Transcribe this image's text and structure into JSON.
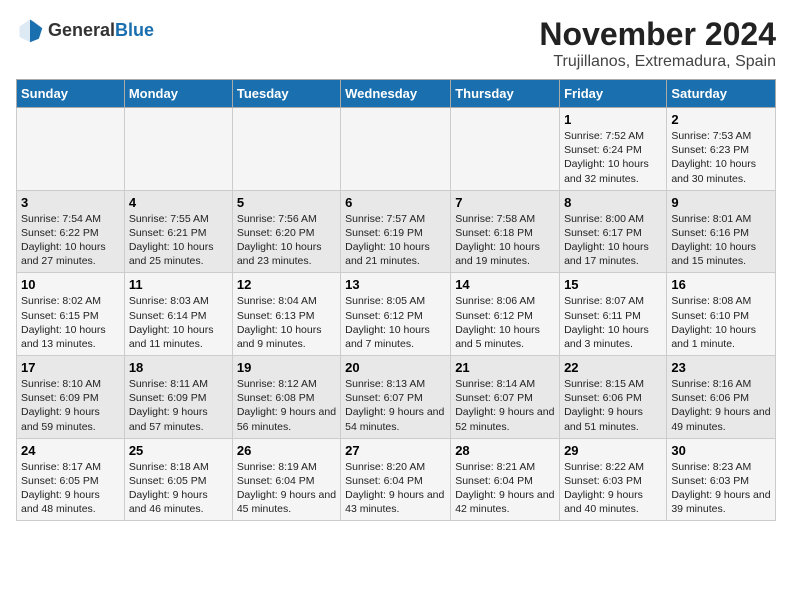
{
  "logo": {
    "text_general": "General",
    "text_blue": "Blue"
  },
  "title": "November 2024",
  "subtitle": "Trujillanos, Extremadura, Spain",
  "days_of_week": [
    "Sunday",
    "Monday",
    "Tuesday",
    "Wednesday",
    "Thursday",
    "Friday",
    "Saturday"
  ],
  "weeks": [
    [
      {
        "day": "",
        "info": ""
      },
      {
        "day": "",
        "info": ""
      },
      {
        "day": "",
        "info": ""
      },
      {
        "day": "",
        "info": ""
      },
      {
        "day": "",
        "info": ""
      },
      {
        "day": "1",
        "info": "Sunrise: 7:52 AM\nSunset: 6:24 PM\nDaylight: 10 hours and 32 minutes."
      },
      {
        "day": "2",
        "info": "Sunrise: 7:53 AM\nSunset: 6:23 PM\nDaylight: 10 hours and 30 minutes."
      }
    ],
    [
      {
        "day": "3",
        "info": "Sunrise: 7:54 AM\nSunset: 6:22 PM\nDaylight: 10 hours and 27 minutes."
      },
      {
        "day": "4",
        "info": "Sunrise: 7:55 AM\nSunset: 6:21 PM\nDaylight: 10 hours and 25 minutes."
      },
      {
        "day": "5",
        "info": "Sunrise: 7:56 AM\nSunset: 6:20 PM\nDaylight: 10 hours and 23 minutes."
      },
      {
        "day": "6",
        "info": "Sunrise: 7:57 AM\nSunset: 6:19 PM\nDaylight: 10 hours and 21 minutes."
      },
      {
        "day": "7",
        "info": "Sunrise: 7:58 AM\nSunset: 6:18 PM\nDaylight: 10 hours and 19 minutes."
      },
      {
        "day": "8",
        "info": "Sunrise: 8:00 AM\nSunset: 6:17 PM\nDaylight: 10 hours and 17 minutes."
      },
      {
        "day": "9",
        "info": "Sunrise: 8:01 AM\nSunset: 6:16 PM\nDaylight: 10 hours and 15 minutes."
      }
    ],
    [
      {
        "day": "10",
        "info": "Sunrise: 8:02 AM\nSunset: 6:15 PM\nDaylight: 10 hours and 13 minutes."
      },
      {
        "day": "11",
        "info": "Sunrise: 8:03 AM\nSunset: 6:14 PM\nDaylight: 10 hours and 11 minutes."
      },
      {
        "day": "12",
        "info": "Sunrise: 8:04 AM\nSunset: 6:13 PM\nDaylight: 10 hours and 9 minutes."
      },
      {
        "day": "13",
        "info": "Sunrise: 8:05 AM\nSunset: 6:12 PM\nDaylight: 10 hours and 7 minutes."
      },
      {
        "day": "14",
        "info": "Sunrise: 8:06 AM\nSunset: 6:12 PM\nDaylight: 10 hours and 5 minutes."
      },
      {
        "day": "15",
        "info": "Sunrise: 8:07 AM\nSunset: 6:11 PM\nDaylight: 10 hours and 3 minutes."
      },
      {
        "day": "16",
        "info": "Sunrise: 8:08 AM\nSunset: 6:10 PM\nDaylight: 10 hours and 1 minute."
      }
    ],
    [
      {
        "day": "17",
        "info": "Sunrise: 8:10 AM\nSunset: 6:09 PM\nDaylight: 9 hours and 59 minutes."
      },
      {
        "day": "18",
        "info": "Sunrise: 8:11 AM\nSunset: 6:09 PM\nDaylight: 9 hours and 57 minutes."
      },
      {
        "day": "19",
        "info": "Sunrise: 8:12 AM\nSunset: 6:08 PM\nDaylight: 9 hours and 56 minutes."
      },
      {
        "day": "20",
        "info": "Sunrise: 8:13 AM\nSunset: 6:07 PM\nDaylight: 9 hours and 54 minutes."
      },
      {
        "day": "21",
        "info": "Sunrise: 8:14 AM\nSunset: 6:07 PM\nDaylight: 9 hours and 52 minutes."
      },
      {
        "day": "22",
        "info": "Sunrise: 8:15 AM\nSunset: 6:06 PM\nDaylight: 9 hours and 51 minutes."
      },
      {
        "day": "23",
        "info": "Sunrise: 8:16 AM\nSunset: 6:06 PM\nDaylight: 9 hours and 49 minutes."
      }
    ],
    [
      {
        "day": "24",
        "info": "Sunrise: 8:17 AM\nSunset: 6:05 PM\nDaylight: 9 hours and 48 minutes."
      },
      {
        "day": "25",
        "info": "Sunrise: 8:18 AM\nSunset: 6:05 PM\nDaylight: 9 hours and 46 minutes."
      },
      {
        "day": "26",
        "info": "Sunrise: 8:19 AM\nSunset: 6:04 PM\nDaylight: 9 hours and 45 minutes."
      },
      {
        "day": "27",
        "info": "Sunrise: 8:20 AM\nSunset: 6:04 PM\nDaylight: 9 hours and 43 minutes."
      },
      {
        "day": "28",
        "info": "Sunrise: 8:21 AM\nSunset: 6:04 PM\nDaylight: 9 hours and 42 minutes."
      },
      {
        "day": "29",
        "info": "Sunrise: 8:22 AM\nSunset: 6:03 PM\nDaylight: 9 hours and 40 minutes."
      },
      {
        "day": "30",
        "info": "Sunrise: 8:23 AM\nSunset: 6:03 PM\nDaylight: 9 hours and 39 minutes."
      }
    ]
  ]
}
